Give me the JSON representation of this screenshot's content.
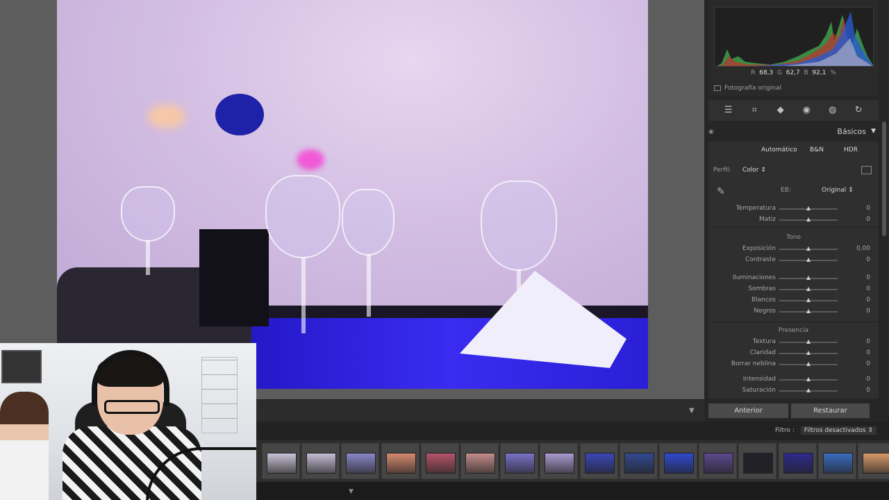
{
  "histogram": {
    "r_label": "R",
    "r_value": "68,3",
    "g_label": "G",
    "g_value": "62,7",
    "b_label": "B",
    "b_value": "92,1",
    "unit": "%",
    "original_photo_label": "Fotografía original"
  },
  "tools": [
    "edit-sliders-icon",
    "crop-icon",
    "healing-icon",
    "red-eye-icon",
    "masking-icon",
    "reset-icon"
  ],
  "basics": {
    "title": "Básicos",
    "auto": "Automático",
    "bw": "B&N",
    "hdr": "HDR",
    "profile_label": "Perfil:",
    "profile_value": "Color",
    "wb_label": "EB:",
    "wb_value": "Original",
    "sliders_wb": [
      {
        "name": "Temperatura",
        "value": "0",
        "pos": 0.5
      },
      {
        "name": "Matiz",
        "value": "0",
        "pos": 0.5
      }
    ],
    "tone_title": "Tono",
    "sliders_tone1": [
      {
        "name": "Exposición",
        "value": "0,00",
        "pos": 0.5
      },
      {
        "name": "Contraste",
        "value": "0",
        "pos": 0.5
      }
    ],
    "sliders_tone2": [
      {
        "name": "Iluminaciones",
        "value": "0",
        "pos": 0.5
      },
      {
        "name": "Sombras",
        "value": "0",
        "pos": 0.5
      },
      {
        "name": "Blancos",
        "value": "0",
        "pos": 0.5
      },
      {
        "name": "Negros",
        "value": "0",
        "pos": 0.5
      }
    ],
    "presence_title": "Presencia",
    "sliders_presence1": [
      {
        "name": "Textura",
        "value": "0",
        "pos": 0.5
      },
      {
        "name": "Claridad",
        "value": "0",
        "pos": 0.5
      },
      {
        "name": "Borrar neblina",
        "value": "0",
        "pos": 0.5
      }
    ],
    "sliders_presence2": [
      {
        "name": "Intensidad",
        "value": "0",
        "pos": 0.5
      },
      {
        "name": "Saturación",
        "value": "0",
        "pos": 0.5
      }
    ]
  },
  "buttons": {
    "previous": "Anterior",
    "reset": "Restaurar"
  },
  "filmstrip": {
    "filter_label": "Filtro :",
    "filter_value": "Filtros desactivados",
    "thumb_colors": [
      "#c9c3d6",
      "#c4bed4",
      "#8a86c8",
      "#d68a6e",
      "#b5556a",
      "#c38d8a",
      "#7a72c8",
      "#a99ad0",
      "#3b47b8",
      "#334a90",
      "#2f4ad0",
      "#5c4a8e",
      "#22202a",
      "#2e2a8c",
      "#3a6cc0",
      "#d89a6a"
    ]
  }
}
